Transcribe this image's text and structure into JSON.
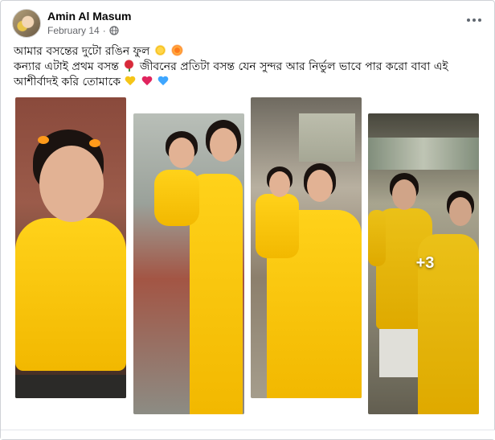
{
  "post": {
    "author": "Amin Al Masum",
    "date": "February 14",
    "date_separator": "·",
    "text_lines": [
      "আমার বসন্তের দুটো রঙিন ফুল",
      "কন্যার এটাই প্রথম বসন্ত",
      "জীবনের প্রতিটা বসন্ত যেন সুন্দর আর নির্ভুল ভাবে পার করো বাবা এই",
      "আশীর্বাদই করি তোমাকে"
    ],
    "heart_colors": [
      "#f5c518",
      "#e0245e",
      "#3ea6ff"
    ]
  },
  "gallery": {
    "more_count": "+3"
  },
  "icons": {
    "globe": "globe-icon",
    "more": "more-options-icon"
  }
}
